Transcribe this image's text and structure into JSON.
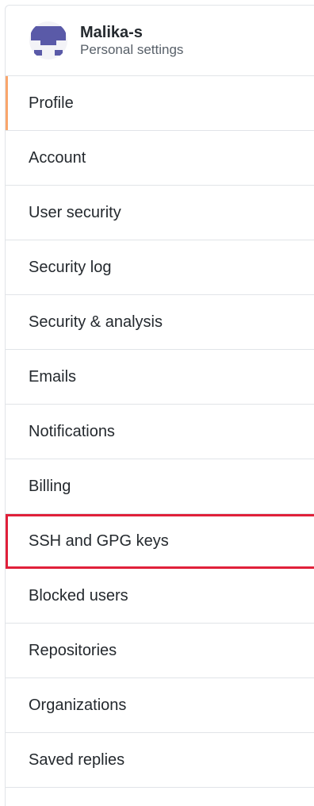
{
  "user": {
    "name": "Malika-s",
    "subtitle": "Personal settings"
  },
  "nav": {
    "items": [
      {
        "label": "Profile"
      },
      {
        "label": "Account"
      },
      {
        "label": "User security"
      },
      {
        "label": "Security log"
      },
      {
        "label": "Security & analysis"
      },
      {
        "label": "Emails"
      },
      {
        "label": "Notifications"
      },
      {
        "label": "Billing"
      },
      {
        "label": "SSH and GPG keys"
      },
      {
        "label": "Blocked users"
      },
      {
        "label": "Repositories"
      },
      {
        "label": "Organizations"
      },
      {
        "label": "Saved replies"
      }
    ],
    "selected": "Profile",
    "highlighted": "SSH and GPG keys"
  },
  "colors": {
    "selected_indicator": "#f66a0a",
    "highlight_box": "#e0203a",
    "avatar": "#5a5aa8"
  }
}
